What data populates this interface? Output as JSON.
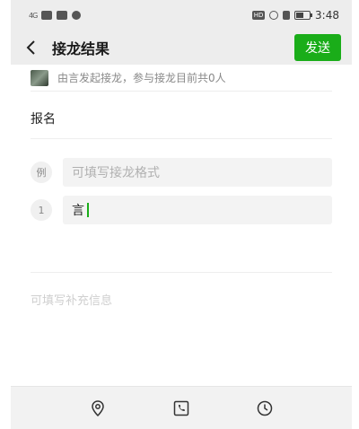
{
  "status_bar": {
    "signal_text": "4G",
    "time": "3:48",
    "hd_badge": "HD",
    "battery_level": "57",
    "battery_percent": 0.57
  },
  "nav": {
    "title": "接龙结果",
    "send_label": "发送"
  },
  "initiator": {
    "text": "由言发起接龙，参与接龙目前共0人"
  },
  "form": {
    "title": "报名",
    "example_badge": "例",
    "example_placeholder": "可填写接龙格式",
    "entries": [
      {
        "index": "1",
        "value": "言"
      }
    ],
    "extra_placeholder": "可填写补充信息"
  },
  "toolbar": {
    "icons": [
      "location-icon",
      "phone-icon",
      "clock-icon"
    ]
  },
  "colors": {
    "accent": "#1aad19",
    "header_bg": "#ededed",
    "toolbar_bg": "#f2f2f2"
  }
}
